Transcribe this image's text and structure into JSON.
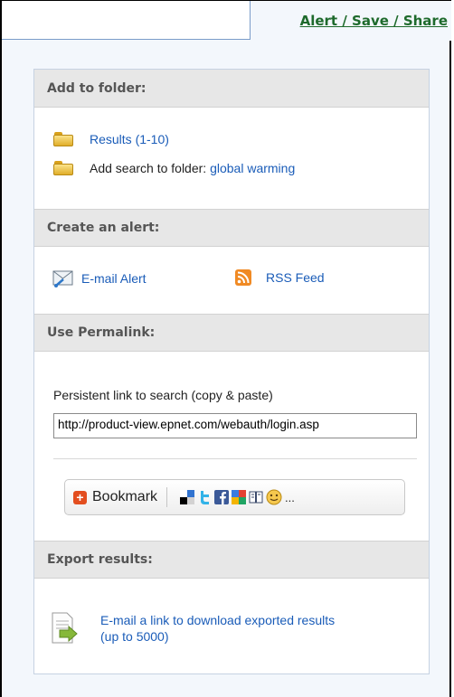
{
  "tabs": {
    "active_label": "Alert / Save / Share"
  },
  "folder_section": {
    "heading": "Add to folder:",
    "results_link": "Results (1-10)",
    "add_search_label": "Add search to folder:",
    "add_search_term": "global warming"
  },
  "alert_section": {
    "heading": "Create an alert:",
    "email_alert": "E-mail Alert",
    "rss_feed": "RSS Feed"
  },
  "permalink_section": {
    "heading": "Use Permalink:",
    "label": "Persistent link to search (copy & paste)",
    "url": "http://product-view.epnet.com/webauth/login.asp",
    "bookmark_label": "Bookmark",
    "bookmark_more": "..."
  },
  "export_section": {
    "heading": "Export results:",
    "link_line1": "E-mail a link to download exported results",
    "link_line2": "(up to 5000)"
  },
  "icons": [
    "folder-icon",
    "email-alert-icon",
    "rss-icon",
    "bookmark-plus-icon",
    "delicious-icon",
    "twitter-icon",
    "facebook-icon",
    "google-icon",
    "book-icon",
    "smiley-icon",
    "export-document-icon"
  ],
  "colors": {
    "link": "#1a5cb8",
    "tab_link": "#1e6a2c",
    "section_header_bg": "#e7e7e7",
    "panel_bg": "#f3f7fc"
  }
}
